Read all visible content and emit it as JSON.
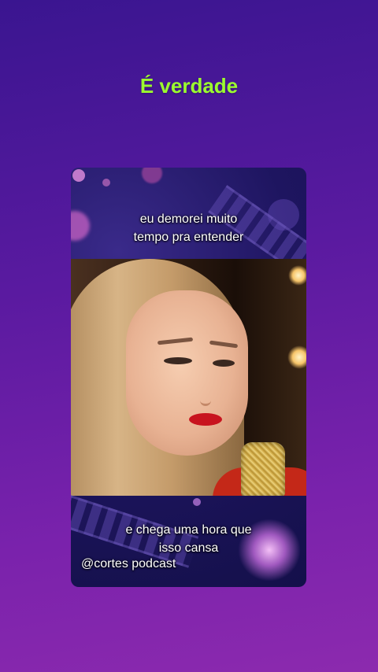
{
  "headline": "É verdade",
  "video": {
    "caption_top": [
      "eu demorei muito",
      "tempo pra entender"
    ],
    "caption_bottom": [
      "e chega uma hora que",
      "isso cansa"
    ],
    "watermark": "@cortes podcast"
  },
  "colors": {
    "headline": "#9cff2e",
    "background_top": "#3a1590",
    "background_bottom": "#8c2aae"
  }
}
